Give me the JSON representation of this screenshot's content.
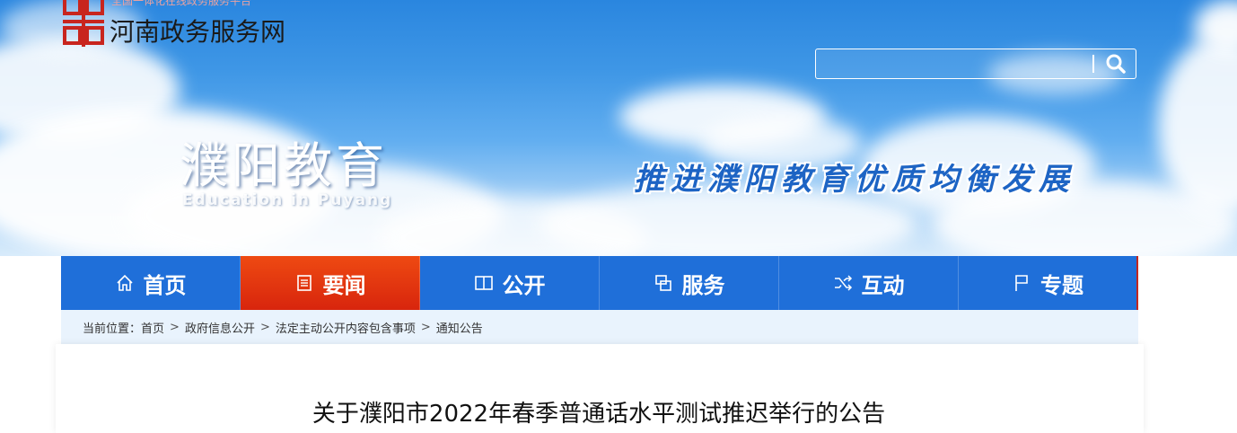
{
  "header": {
    "site_tagline": "全国一体化在线政务服务平台",
    "site_name": "河南政务服务网",
    "search": {
      "placeholder": "",
      "value": ""
    }
  },
  "banner": {
    "brand_cn": "濮阳教育",
    "brand_en": "Education in Puyang",
    "slogan": "推进濮阳教育优质均衡发展"
  },
  "nav": {
    "items": [
      {
        "label": "首页",
        "icon": "home-icon",
        "active": false
      },
      {
        "label": "要闻",
        "icon": "document-icon",
        "active": true
      },
      {
        "label": "公开",
        "icon": "book-icon",
        "active": false
      },
      {
        "label": "服务",
        "icon": "windows-icon",
        "active": false
      },
      {
        "label": "互动",
        "icon": "shuffle-icon",
        "active": false
      },
      {
        "label": "专题",
        "icon": "flag-icon",
        "active": false
      }
    ]
  },
  "breadcrumb": {
    "lead": "当前位置：",
    "items": [
      "首页",
      "政府信息公开",
      "法定主动公开内容包含事项",
      "通知公告"
    ],
    "separator": ">"
  },
  "article": {
    "title": "关于濮阳市2022年春季普通话水平测试推迟举行的公告"
  },
  "colors": {
    "nav_bg": "#1f6fd9",
    "nav_active": "#e3350f",
    "breadcrumb_bg": "#e9f3fd",
    "slogan": "#1d64c4",
    "logo_red": "#c8251e"
  }
}
